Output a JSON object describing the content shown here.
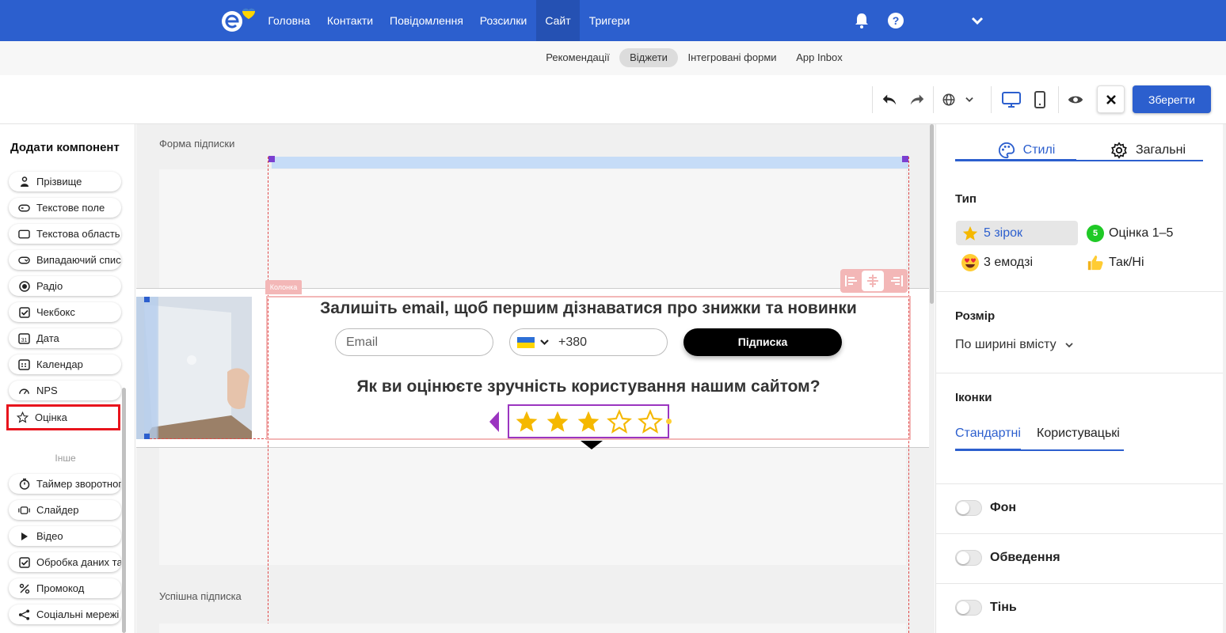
{
  "topnav": {
    "items": [
      {
        "label": "Головна"
      },
      {
        "label": "Контакти"
      },
      {
        "label": "Повідомлення"
      },
      {
        "label": "Розсилки"
      },
      {
        "label": "Сайт"
      },
      {
        "label": "Тригери"
      }
    ],
    "active_item": "Сайт",
    "icons": [
      "bell-icon",
      "help-icon",
      "chevron-down-icon"
    ]
  },
  "subnav": {
    "items": [
      {
        "label": "Рекомендації"
      },
      {
        "label": "Віджети"
      },
      {
        "label": "Інтегровані форми"
      },
      {
        "label": "App Inbox"
      }
    ],
    "active_item": "Віджети"
  },
  "toolbar": {
    "save_label": "Зберегти",
    "icons": [
      "undo-icon",
      "redo-icon",
      "globe-icon",
      "chevron-down-icon",
      "desktop-icon",
      "mobile-icon",
      "eye-icon",
      "close-icon"
    ]
  },
  "left_panel": {
    "title": "Додати компонент",
    "components": [
      {
        "label": "Прізвище",
        "icon": "person-icon"
      },
      {
        "label": "Текстове поле",
        "icon": "text-field-icon"
      },
      {
        "label": "Текстова область",
        "icon": "text-area-icon"
      },
      {
        "label": "Випадаючий список",
        "icon": "dropdown-icon"
      },
      {
        "label": "Радіо",
        "icon": "radio-icon"
      },
      {
        "label": "Чекбокс",
        "icon": "checkbox-icon"
      },
      {
        "label": "Дата",
        "icon": "date-icon"
      },
      {
        "label": "Календар",
        "icon": "calendar-icon"
      },
      {
        "label": "NPS",
        "icon": "gauge-icon"
      },
      {
        "label": "Оцінка",
        "icon": "star-outline-icon"
      }
    ],
    "section_other": "Інше",
    "other_components": [
      {
        "label": "Таймер зворотного відліку",
        "icon": "timer-icon"
      },
      {
        "label": "Слайдер",
        "icon": "slider-icon"
      },
      {
        "label": "Відео",
        "icon": "play-icon"
      },
      {
        "label": "Обробка даних та згода",
        "icon": "checkbox-icon"
      },
      {
        "label": "Промокод",
        "icon": "percent-icon"
      },
      {
        "label": "Соціальні мережі",
        "icon": "share-icon"
      }
    ]
  },
  "canvas": {
    "section_title": "Форма підписки",
    "column_tag": "Колонка",
    "heading": "Залишіть email, щоб першим дізнаватися про знижки та новинки",
    "email_placeholder": "Email",
    "phone_code": "+380",
    "subscribe_label": "Підписка",
    "question": "Як ви оцінюєте зручність користування нашим сайтом?",
    "rating": {
      "filled": 3,
      "total": 5,
      "color": "#f5b800"
    },
    "success_title": "Успішна підписка"
  },
  "right_panel": {
    "tabs": [
      {
        "label": "Стилі",
        "icon": "palette-icon"
      },
      {
        "label": "Загальні",
        "icon": "gear-icon"
      }
    ],
    "active_tab": "Стилі",
    "type_title": "Тип",
    "types": [
      {
        "label": "5 зірок",
        "icon": "star-emoji-icon"
      },
      {
        "label": "Оцінка 1–5",
        "icon": "score-badge-icon",
        "badge": "5"
      },
      {
        "label": "3 емодзі",
        "icon": "heart-eyes-emoji-icon"
      },
      {
        "label": "Так/Ні",
        "icon": "thumbs-up-icon"
      }
    ],
    "active_type": "5 зірок",
    "size_title": "Розмір",
    "size_value": "По ширині вмісту",
    "icons_title": "Іконки",
    "icon_tabs": [
      "Стандартні",
      "Користувацькі"
    ],
    "active_icon_tab": "Стандартні",
    "toggles": [
      {
        "label": "Фон",
        "on": false
      },
      {
        "label": "Обведення",
        "on": false
      },
      {
        "label": "Тінь",
        "on": false
      }
    ]
  },
  "colors": {
    "brand": "#2c5fce",
    "highlight": "#e8141c",
    "star": "#f5b800",
    "selection": "#9b35c0"
  }
}
